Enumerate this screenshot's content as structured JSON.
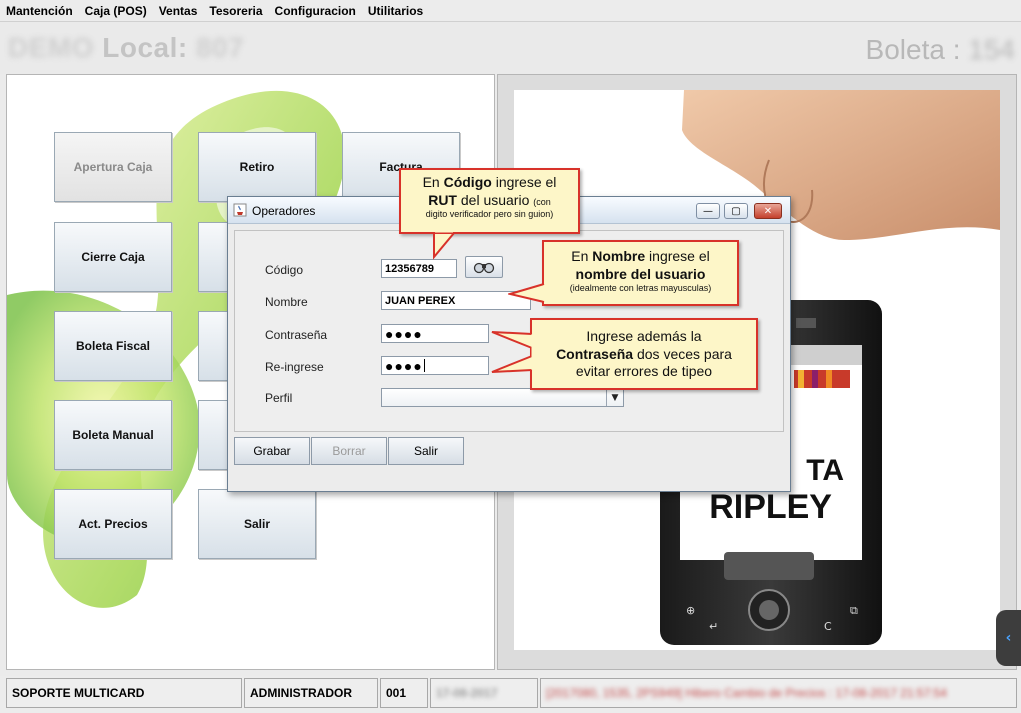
{
  "menu": [
    "Mantención",
    "Caja (POS)",
    "Ventas",
    "Tesoreria",
    "Configuracion",
    "Utilitarios"
  ],
  "header": {
    "local_prefix": "DEMO",
    "local_label": "Local:",
    "local_number": "807",
    "boleta_label": "Boleta :",
    "boleta_number": "154"
  },
  "buttons": {
    "apertura_caja": "Apertura Caja",
    "retiro": "Retiro",
    "factura": "Factura",
    "cierre_caja": "Cierre Caja",
    "boleta_fiscal": "Boleta Fiscal",
    "boleta_manual": "Boleta Manual",
    "act_precios": "Act. Precios",
    "salir": "Salir"
  },
  "ad": {
    "line1": "TA",
    "line2": "RIPLEY"
  },
  "dialog": {
    "title": "Operadores",
    "labels": {
      "codigo": "Código",
      "nombre": "Nombre",
      "contrasena": "Contraseña",
      "reingrese": "Re-ingrese",
      "perfil": "Perfil"
    },
    "values": {
      "codigo": "12356789",
      "nombre": "JUAN PEREX",
      "contrasena": "●●●●",
      "reingrese": "●●●●",
      "perfil": ""
    },
    "buttons": {
      "grabar": "Grabar",
      "borrar": "Borrar",
      "salir": "Salir"
    }
  },
  "callouts": {
    "codigo": {
      "t1": "En ",
      "b1": "Código",
      "t2": " ingrese el",
      "b2": "RUT",
      "t3": " del usuario ",
      "s1": "(con",
      "s2": "digito verificador pero sin guion)"
    },
    "nombre": {
      "t1": "En ",
      "b1": "Nombre",
      "t2": " ingrese el",
      "b2": "nombre del usuario",
      "s1": "(idealmente con letras mayusculas)"
    },
    "contrasena": {
      "t1": "Ingrese además la",
      "b1": "Contraseña",
      "t2": " dos veces para",
      "t3": "evitar errores de tipeo"
    }
  },
  "statusbar": {
    "soporte": "SOPORTE MULTICARD",
    "usuario": "ADMINISTRADOR",
    "caja": "001",
    "fecha": "17-08-2017",
    "mensaje": "[2017080, 1535, 2PS949] Hibero Cambio de Precios : 17-08-2017 21:57:54"
  },
  "colors": {
    "callout_border": "#d8322a",
    "callout_fill": "#fdf6c8",
    "button_top": "#f7f9fb",
    "button_bottom": "#d7e0e8"
  }
}
